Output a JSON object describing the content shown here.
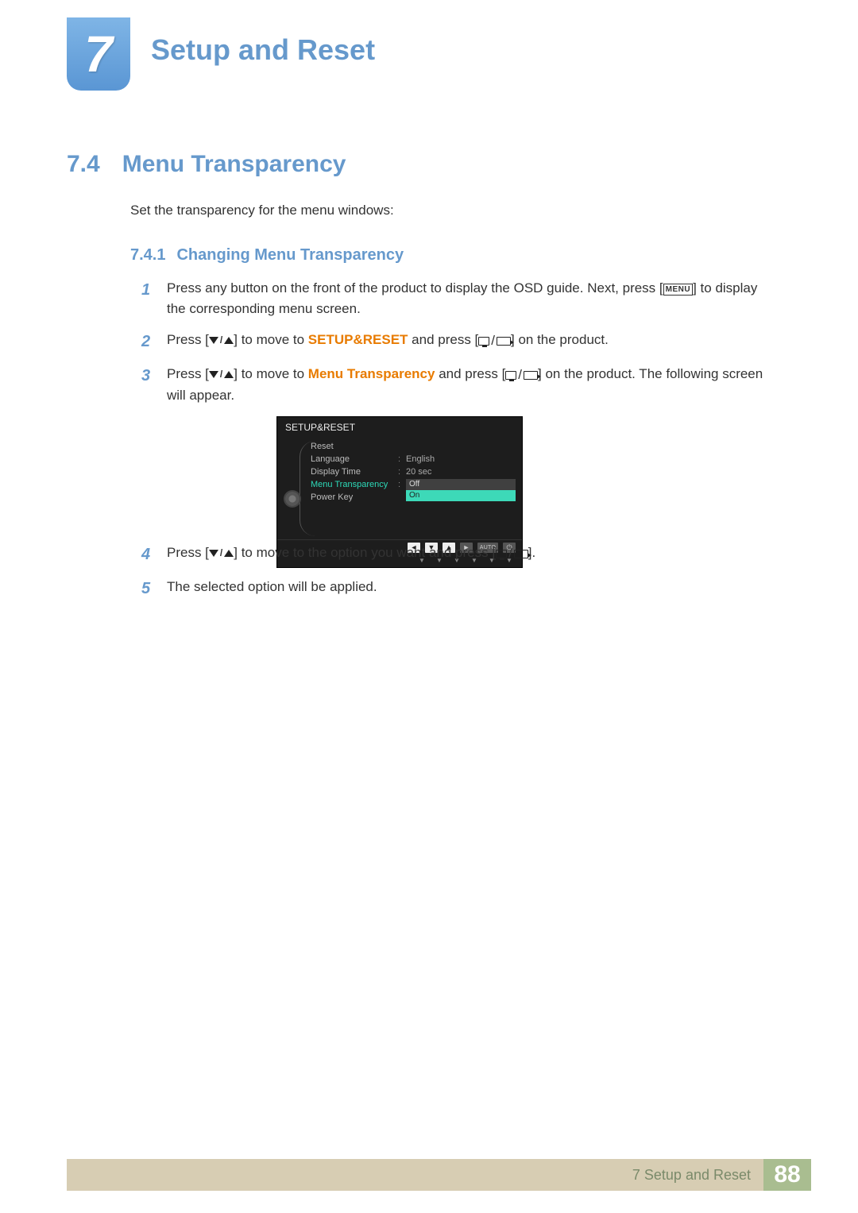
{
  "chapter": {
    "number": "7",
    "title": "Setup and Reset"
  },
  "section": {
    "number": "7.4",
    "title": "Menu Transparency"
  },
  "intro": "Set the transparency for the menu windows:",
  "subsection": {
    "number": "7.4.1",
    "title": "Changing Menu Transparency"
  },
  "steps": {
    "s1_a": "Press any button on the front of the product to display the OSD guide. Next, press [",
    "s1_menu": "MENU",
    "s1_b": "] to display the corresponding menu screen.",
    "s2_a": "Press [",
    "s2_b": "] to move to ",
    "s2_hl": "SETUP&RESET",
    "s2_c": " and press [",
    "s2_d": "] on the product.",
    "s3_a": "Press [",
    "s3_b": "] to move to ",
    "s3_hl": "Menu Transparency",
    "s3_c": " and press [",
    "s3_d": "] on the product. The following screen will appear.",
    "s4_a": "Press [",
    "s4_b": "] to move to the option you want and press [",
    "s4_c": "].",
    "s5": "The selected option will be applied."
  },
  "osd": {
    "title": "SETUP&RESET",
    "rows": [
      {
        "label": "Reset",
        "value": ""
      },
      {
        "label": "Language",
        "value": "English"
      },
      {
        "label": "Display Time",
        "value": "20 sec"
      },
      {
        "label": "Menu Transparency",
        "value": "",
        "active": true,
        "options": [
          "Off",
          "On"
        ],
        "selected": "On"
      },
      {
        "label": "Power Key",
        "value": ""
      }
    ],
    "nav_auto": "AUTO"
  },
  "footer": {
    "crumb": "7 Setup and Reset",
    "page": "88"
  }
}
